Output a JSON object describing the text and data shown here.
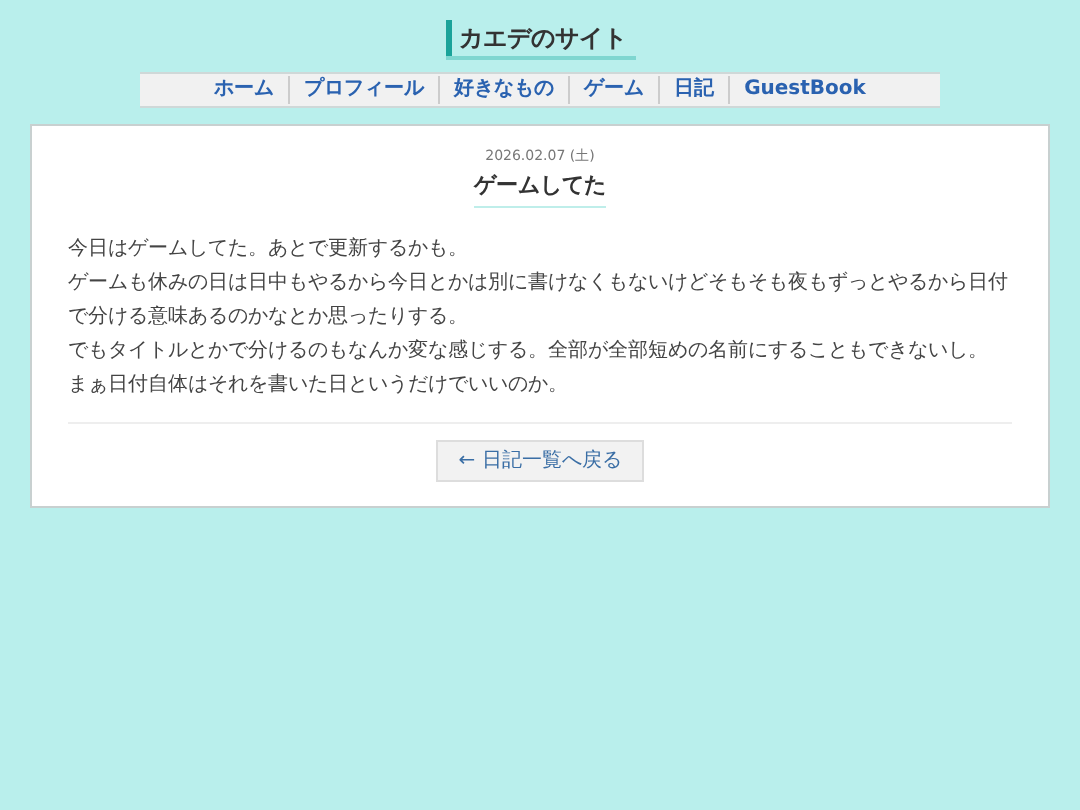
{
  "site_title": "カエデのサイト",
  "nav": [
    {
      "label": "ホーム"
    },
    {
      "label": "プロフィール"
    },
    {
      "label": "好きなもの"
    },
    {
      "label": "ゲーム"
    },
    {
      "label": "日記"
    },
    {
      "label": "GuestBook"
    }
  ],
  "post": {
    "date": "2026.02.07 (土)",
    "title": "ゲームしてた",
    "lines": [
      "今日はゲームしてた。あとで更新するかも。",
      "ゲームも休みの日は日中もやるから今日とかは別に書けなくもないけどそもそも夜もずっとやるから日付で分ける意味あるのかなとか思ったりする。",
      "でもタイトルとかで分けるのもなんか変な感じする。全部が全部短めの名前にすることもできないし。",
      "まぁ日付自体はそれを書いた日というだけでいいのか。"
    ],
    "back_button": "← 日記一覧へ戻る"
  }
}
